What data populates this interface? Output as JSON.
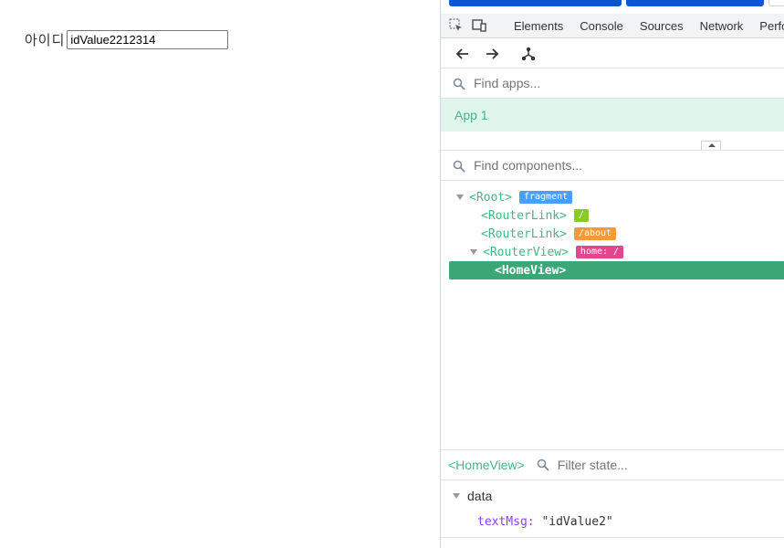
{
  "page": {
    "id_label": "아이디",
    "id_value": "idValue2212314"
  },
  "devtools": {
    "tabs": [
      "Elements",
      "Console",
      "Sources",
      "Network",
      "Perfo"
    ],
    "find_apps_placeholder": "Find apps...",
    "app_name": "App 1",
    "find_components_placeholder": "Find components...",
    "tree": [
      {
        "tag": "<Root>",
        "badge": "fragment",
        "badge_color": "#4a9eff",
        "indent": 0,
        "caret": true
      },
      {
        "tag": "<RouterLink>",
        "badge": "/",
        "badge_color": "#8ac926",
        "indent": 1,
        "caret": false
      },
      {
        "tag": "<RouterLink>",
        "badge": "/about",
        "badge_color": "#f59a3a",
        "indent": 1,
        "caret": false
      },
      {
        "tag": "<RouterView>",
        "badge": "home: /",
        "badge_color": "#e0478f",
        "indent": 1,
        "caret": true
      },
      {
        "tag": "<HomeView>",
        "badge": "",
        "badge_color": "",
        "indent": 2,
        "caret": false,
        "selected": true
      }
    ],
    "selected_component": "<HomeView>",
    "filter_state_placeholder": "Filter state...",
    "data_section_title": "data",
    "data_key": "textMsg",
    "data_colon": ":",
    "data_value": "\"idValue2\""
  },
  "colors": {
    "vue_green": "#42b883",
    "selected_row": "#3ba776",
    "app_row_bg": "#e0f6ec",
    "top_button": "#0b57d0"
  }
}
